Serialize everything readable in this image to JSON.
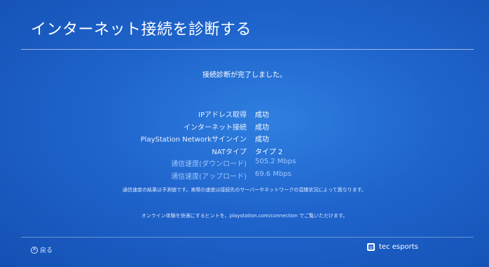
{
  "header": {
    "title": "インターネット接続を診断する"
  },
  "status": {
    "message": "接続診断が完了しました。"
  },
  "results": [
    {
      "label": "IPアドレス取得",
      "value": "成功"
    },
    {
      "label": "インターネット接続",
      "value": "成功"
    },
    {
      "label": "PlayStation Networkサインイン",
      "value": "成功"
    },
    {
      "label": "NATタイプ",
      "value": "タイプ 2"
    },
    {
      "label": "通信速度(ダウンロード)",
      "value": "505.2 Mbps"
    },
    {
      "label": "通信速度(アップロード)",
      "value": "69.6 Mbps"
    }
  ],
  "note": "通信速度の結果は予測値です。実際の速度は接続先のサーバーやネットワークの混雑状況によって異なります。",
  "hint": "オンライン体験を快適にするヒントを、playstation.com/connection でご覧いただけます。",
  "footer": {
    "back_symbol": "✕",
    "back_label": "戻る",
    "user_name": "tec esports"
  },
  "colors": {
    "background": "#1f64cc",
    "speed_text": "#9cc6ff"
  }
}
